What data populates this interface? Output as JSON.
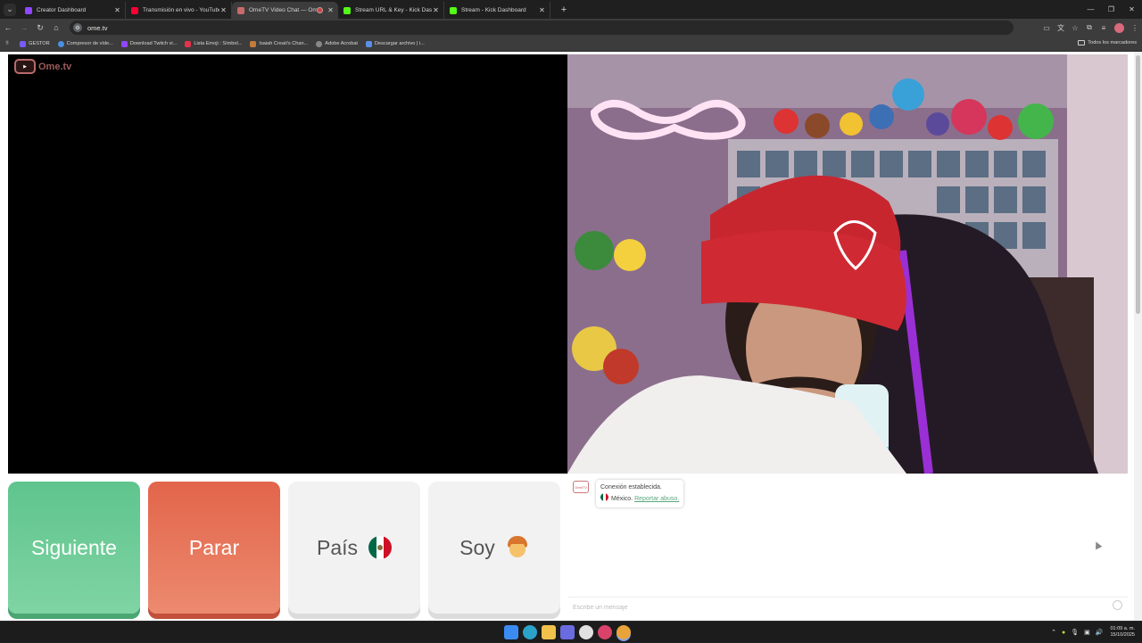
{
  "browser": {
    "tabs": [
      {
        "title": "Creator Dashboard",
        "icon": "twitch-icon",
        "color": "#9146ff"
      },
      {
        "title": "Transmisión en vivo - YouTube",
        "icon": "youtube-icon",
        "color": "#ff0033"
      },
      {
        "title": "OmeTV Video Chat — Ome",
        "icon": "ometv-icon",
        "color": "#c96a6a",
        "active": true
      },
      {
        "title": "Stream URL & Key - Kick Dashb",
        "icon": "kick-icon",
        "color": "#53fc18"
      },
      {
        "title": "Stream - Kick Dashboard",
        "icon": "kick-icon",
        "color": "#53fc18"
      }
    ],
    "url": "ome.tv",
    "bookmarks": [
      {
        "label": "GESTOR",
        "color": "#7a5af8"
      },
      {
        "label": "Compresor de víde...",
        "color": "#4a90e2"
      },
      {
        "label": "Download Twitch vi...",
        "color": "#9146ff"
      },
      {
        "label": "Lista Emoji : Símbol...",
        "color": "#e2334b"
      },
      {
        "label": "Isaiah Creati's Chan...",
        "color": "#c47a3a"
      },
      {
        "label": "Adobe Acrobat",
        "color": "#888888"
      },
      {
        "label": "Descargar archivo | i...",
        "color": "#5b8ee6"
      }
    ],
    "all_bookmarks": "Todos los marcadores"
  },
  "ometv": {
    "logo": "Ome.tv",
    "buttons": {
      "next": "Siguiente",
      "stop": "Parar",
      "country": "País",
      "gender": "Soy"
    },
    "chat": {
      "status": "Conexión establecida.",
      "country": "México.",
      "report": "Reportar abuso.",
      "placeholder": "Escribe un mensaje"
    }
  },
  "taskbar": {
    "time": "01:09 a. m.",
    "date": "15/10/2025"
  }
}
